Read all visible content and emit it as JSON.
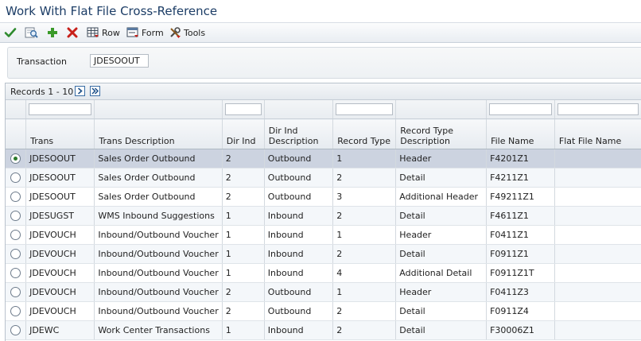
{
  "window": {
    "title": "Work With Flat File Cross-Reference"
  },
  "toolbar": {
    "ok_icon": "check-icon",
    "find_icon": "find-icon",
    "add_icon": "add-icon",
    "delete_icon": "delete-icon",
    "row_label": "Row",
    "form_label": "Form",
    "tools_label": "Tools"
  },
  "filter": {
    "transaction_label": "Transaction",
    "transaction_value": "JDESOOUT"
  },
  "grid": {
    "records_text": "Records 1 - 10",
    "columns": [
      {
        "key": "trans",
        "label": "Trans"
      },
      {
        "key": "trans_desc",
        "label": "Trans Description"
      },
      {
        "key": "dir_ind",
        "label": "Dir Ind"
      },
      {
        "key": "dir_ind_desc",
        "label": "Dir Ind Description"
      },
      {
        "key": "record_type",
        "label": "Record Type"
      },
      {
        "key": "record_type_desc",
        "label": "Record Type Description"
      },
      {
        "key": "file_name",
        "label": "File Name"
      },
      {
        "key": "flat_file_name",
        "label": "Flat File Name"
      }
    ],
    "rows": [
      {
        "trans": "JDESOOUT",
        "trans_desc": "Sales Order Outbound",
        "dir_ind": "2",
        "dir_ind_desc": "Outbound",
        "record_type": "1",
        "record_type_desc": "Header",
        "file_name": "F4201Z1",
        "flat_file_name": "",
        "selected": true
      },
      {
        "trans": "JDESOOUT",
        "trans_desc": "Sales Order Outbound",
        "dir_ind": "2",
        "dir_ind_desc": "Outbound",
        "record_type": "2",
        "record_type_desc": "Detail",
        "file_name": "F4211Z1",
        "flat_file_name": "",
        "selected": false
      },
      {
        "trans": "JDESOOUT",
        "trans_desc": "Sales Order Outbound",
        "dir_ind": "2",
        "dir_ind_desc": "Outbound",
        "record_type": "3",
        "record_type_desc": "Additional Header",
        "file_name": "F49211Z1",
        "flat_file_name": "",
        "selected": false
      },
      {
        "trans": "JDESUGST",
        "trans_desc": "WMS Inbound Suggestions",
        "dir_ind": "1",
        "dir_ind_desc": "Inbound",
        "record_type": "2",
        "record_type_desc": "Detail",
        "file_name": "F4611Z1",
        "flat_file_name": "",
        "selected": false
      },
      {
        "trans": "JDEVOUCH",
        "trans_desc": "Inbound/Outbound Voucher",
        "dir_ind": "1",
        "dir_ind_desc": "Inbound",
        "record_type": "1",
        "record_type_desc": "Header",
        "file_name": "F0411Z1",
        "flat_file_name": "",
        "selected": false
      },
      {
        "trans": "JDEVOUCH",
        "trans_desc": "Inbound/Outbound Voucher",
        "dir_ind": "1",
        "dir_ind_desc": "Inbound",
        "record_type": "2",
        "record_type_desc": "Detail",
        "file_name": "F0911Z1",
        "flat_file_name": "",
        "selected": false
      },
      {
        "trans": "JDEVOUCH",
        "trans_desc": "Inbound/Outbound Voucher",
        "dir_ind": "1",
        "dir_ind_desc": "Inbound",
        "record_type": "4",
        "record_type_desc": "Additional Detail",
        "file_name": "F0911Z1T",
        "flat_file_name": "",
        "selected": false
      },
      {
        "trans": "JDEVOUCH",
        "trans_desc": "Inbound/Outbound Voucher",
        "dir_ind": "2",
        "dir_ind_desc": "Outbound",
        "record_type": "1",
        "record_type_desc": "Header",
        "file_name": "F0411Z3",
        "flat_file_name": "",
        "selected": false
      },
      {
        "trans": "JDEVOUCH",
        "trans_desc": "Inbound/Outbound Voucher",
        "dir_ind": "2",
        "dir_ind_desc": "Outbound",
        "record_type": "2",
        "record_type_desc": "Detail",
        "file_name": "F0911Z4",
        "flat_file_name": "",
        "selected": false
      },
      {
        "trans": "JDEWC",
        "trans_desc": "Work Center Transactions",
        "dir_ind": "1",
        "dir_ind_desc": "Inbound",
        "record_type": "2",
        "record_type_desc": "Detail",
        "file_name": "F30006Z1",
        "flat_file_name": "",
        "selected": false
      }
    ]
  },
  "colors": {
    "title": "#1c3d66",
    "selected_row": "#ccd3e0",
    "alt_row": "#f4f7fa",
    "ok_green": "#2d8a2d",
    "add_green": "#3a9a2a",
    "delete_red": "#c8201a"
  }
}
